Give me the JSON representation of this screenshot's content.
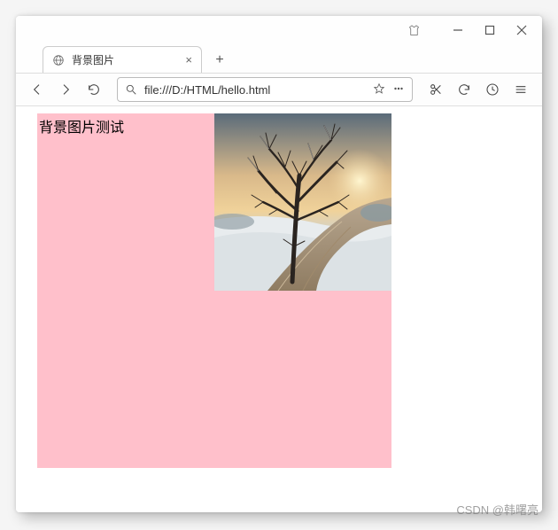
{
  "window": {
    "tab_title": "背景图片",
    "url": "file:///D:/HTML/hello.html"
  },
  "page": {
    "heading": "背景图片测试"
  },
  "watermark": "CSDN @韩曙亮"
}
